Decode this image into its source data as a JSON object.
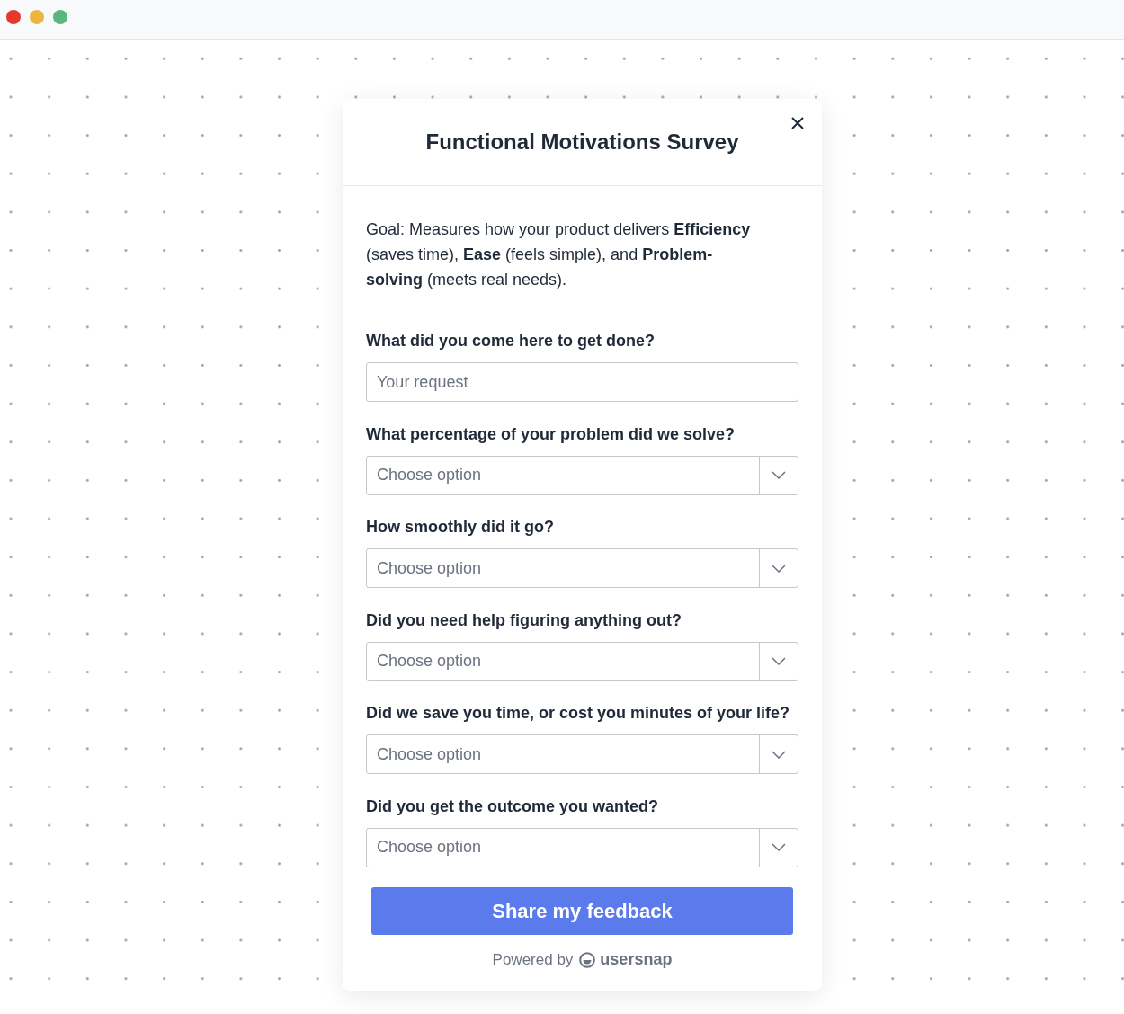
{
  "window": {
    "controls": [
      {
        "color": "#e5392b"
      },
      {
        "color": "#ecb540"
      },
      {
        "color": "#5bb57f"
      }
    ]
  },
  "survey": {
    "title": "Functional Motivations Survey",
    "intro": "Goal: Measures how your product delivers **Efficiency** (saves time), **Ease** (feels simple), and **Problem-solving** (meets real needs).",
    "questions": [
      {
        "kind": "text",
        "label": "What did you come here to get done?",
        "placeholder": "Your request"
      },
      {
        "kind": "select",
        "label": "What percentage of your problem did we solve?",
        "placeholder": "Choose option"
      },
      {
        "kind": "select",
        "label": "How smoothly did it go?",
        "placeholder": "Choose option"
      },
      {
        "kind": "select",
        "label": "Did you need help figuring anything out?",
        "placeholder": "Choose option"
      },
      {
        "kind": "select",
        "label": "Did we save you time, or cost you minutes of your life?",
        "placeholder": "Choose option"
      },
      {
        "kind": "select",
        "label": "Did you get the outcome you wanted?",
        "placeholder": "Choose option"
      }
    ],
    "submit": "Share my feedback",
    "footer": {
      "prefix": "Powered by",
      "brand": "usersnap"
    }
  }
}
